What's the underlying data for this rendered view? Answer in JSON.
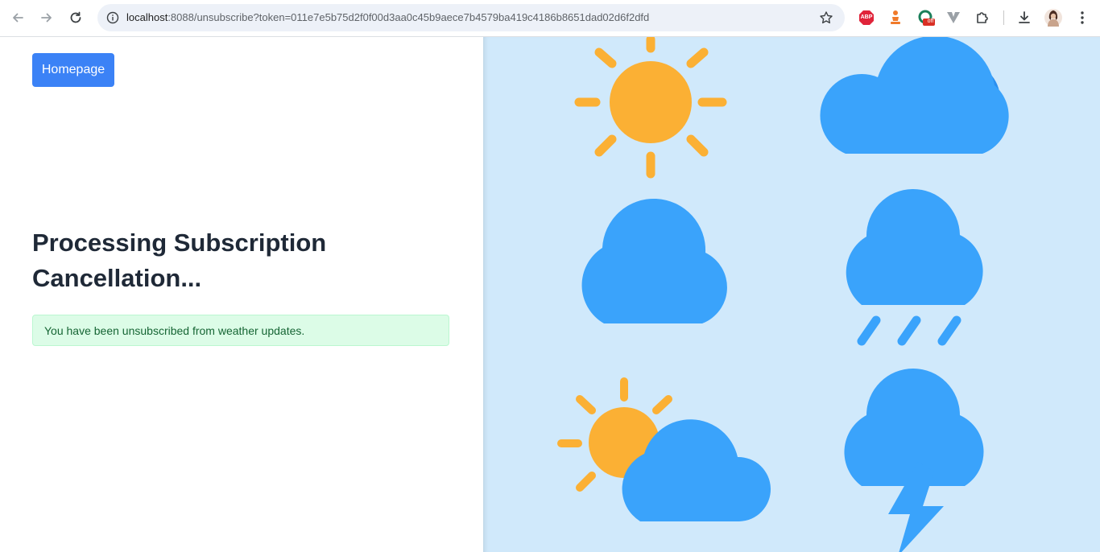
{
  "browser": {
    "url_host": "localhost",
    "url_rest": ":8088/unsubscribe?token=011e7e5b75d2f0f00d3aa0c45b9aece7b4579ba419c4186b8651dad02d6f2dfd",
    "icons": [
      "back-icon",
      "forward-icon",
      "reload-icon",
      "site-info-icon",
      "bookmark-star-icon",
      "adblock-icon",
      "extension-chess-icon",
      "extension-off-icon",
      "extension-v-icon",
      "extensions-puzzle-icon",
      "download-icon",
      "profile-avatar",
      "menu-icon"
    ],
    "adblock_label": "ABP",
    "off_badge": "off"
  },
  "page": {
    "home_button": "Homepage",
    "title": "Processing Subscription Cancellation...",
    "alert": "You have been unsubscribed from weather updates."
  },
  "illustration": {
    "icons": [
      "sun-icon",
      "cloud-icon",
      "cloud-icon",
      "rain-cloud-icon",
      "sun-behind-cloud-icon",
      "thunder-cloud-icon"
    ],
    "colors": {
      "background": "#d0e9fb",
      "sun": "#fbb034",
      "cloud": "#3aa3fb",
      "cloud_shade": "#2a8ff0",
      "alert_bg": "#dcfce7",
      "button": "#3b82f6"
    }
  }
}
